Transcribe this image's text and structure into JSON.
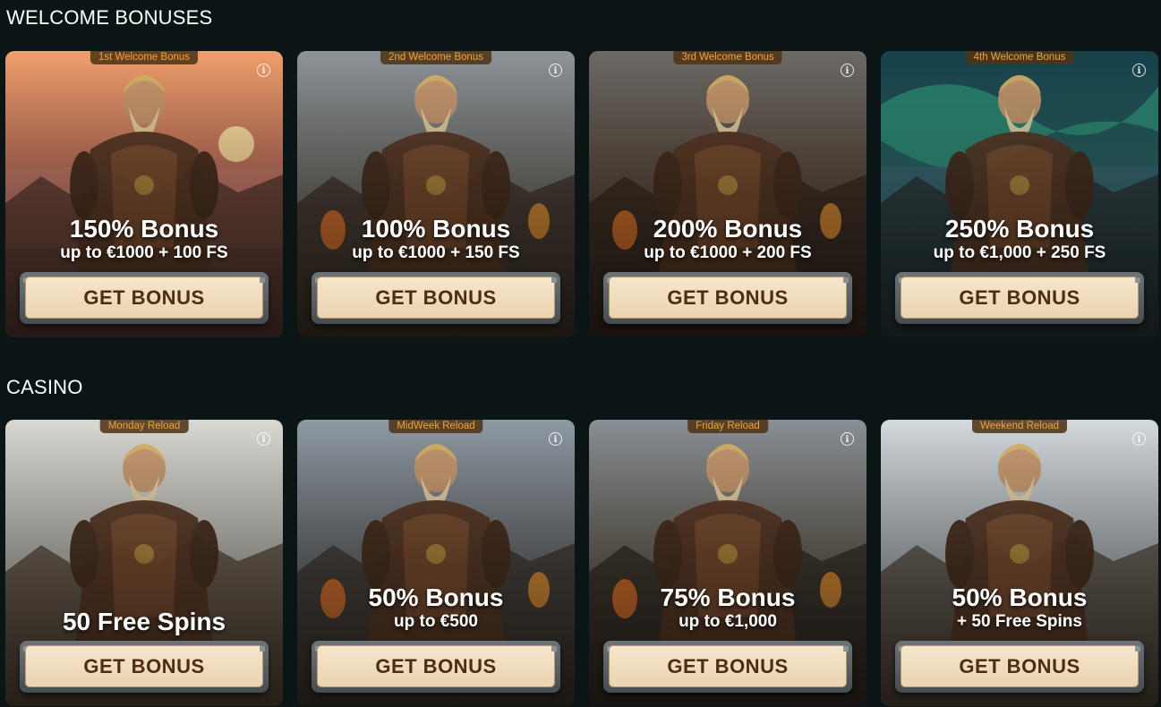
{
  "sections": [
    {
      "title": "WELCOME BONUSES",
      "cards": [
        {
          "tag": "1st Welcome Bonus",
          "headline": "150% Bonus",
          "subline": "up to €1000 + 100 FS",
          "button": "GET BONUS",
          "theme": "sunset"
        },
        {
          "tag": "2nd Welcome Bonus",
          "headline": "100% Bonus",
          "subline": "up to €1000 + 150 FS",
          "button": "GET BONUS",
          "theme": "battle"
        },
        {
          "tag": "3rd Welcome Bonus",
          "headline": "200% Bonus",
          "subline": "up to €1000 + 200 FS",
          "button": "GET BONUS",
          "theme": "fire"
        },
        {
          "tag": "4th Welcome Bonus",
          "headline": "250% Bonus",
          "subline": "up to €1,000 + 250 FS",
          "button": "GET BONUS",
          "theme": "aurora"
        }
      ]
    },
    {
      "title": "CASINO",
      "cards": [
        {
          "tag": "Monday Reload",
          "headline": "50 Free Spins",
          "subline": "",
          "button": "GET BONUS",
          "theme": "morning"
        },
        {
          "tag": "MidWeek Reload",
          "headline": "50% Bonus",
          "subline": "up to €500",
          "button": "GET BONUS",
          "theme": "village"
        },
        {
          "tag": "Friday Reload",
          "headline": "75% Bonus",
          "subline": "up to €1,000",
          "button": "GET BONUS",
          "theme": "treasure"
        },
        {
          "tag": "Weekend Reload",
          "headline": "50% Bonus",
          "subline": "+ 50 Free Spins",
          "button": "GET BONUS",
          "theme": "banner"
        }
      ]
    }
  ],
  "info_icon_glyph": "i",
  "colors": {
    "background": "#0b1516",
    "tag_text": "#f2a33a",
    "button_face": "#f2dec1",
    "button_text": "#4c2d16"
  }
}
